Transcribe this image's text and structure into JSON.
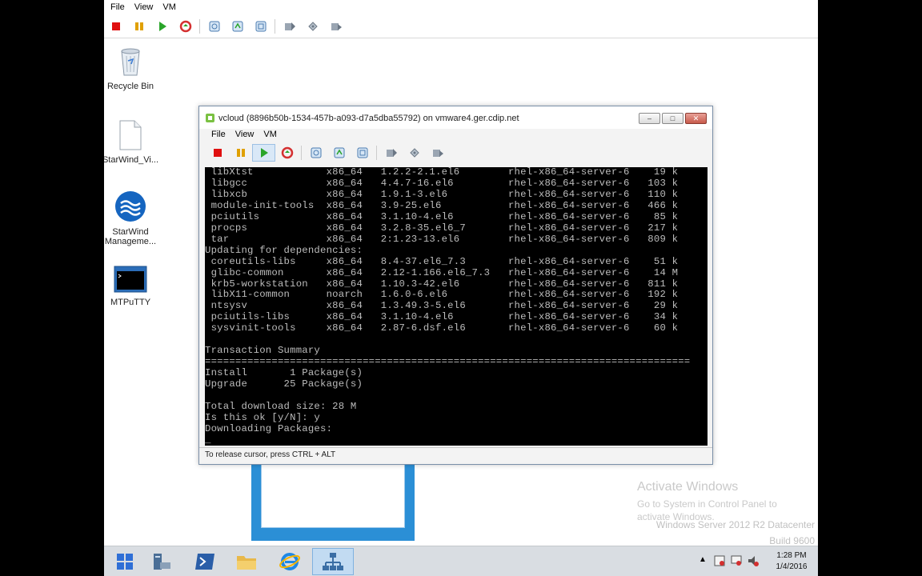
{
  "outer_vm": {
    "menu": [
      "File",
      "View",
      "VM"
    ],
    "toolbar_icons": [
      "stop-icon",
      "pause-icon",
      "play-icon",
      "reset-icon",
      "snapshot-icon",
      "revert-snapshot-icon",
      "manage-snapshots-icon",
      "send-keys-icon",
      "connect-cd-icon",
      "connect-floppy-icon"
    ]
  },
  "desktop": {
    "icons": [
      {
        "label": "Recycle Bin",
        "icon": "recycle-bin-icon"
      },
      {
        "label": "StarWind_Vi...",
        "icon": "document-icon"
      },
      {
        "label": "StarWind Manageme...",
        "icon": "starwind-icon"
      },
      {
        "label": "MTPuTTY",
        "icon": "putty-icon"
      }
    ]
  },
  "vcloud_window": {
    "title": "vcloud (8896b50b-1534-457b-a093-d7a5dba55792) on vmware4.ger.cdip.net",
    "menu": [
      "File",
      "View",
      "VM"
    ],
    "status": "To release cursor, press CTRL + ALT",
    "console_lines": [
      " libXtst            x86_64   1.2.2-2.1.el6        rhel-x86_64-server-6    19 k",
      " libgcc             x86_64   4.4.7-16.el6         rhel-x86_64-server-6   103 k",
      " libxcb             x86_64   1.9.1-3.el6          rhel-x86_64-server-6   110 k",
      " module-init-tools  x86_64   3.9-25.el6           rhel-x86_64-server-6   466 k",
      " pciutils           x86_64   3.1.10-4.el6         rhel-x86_64-server-6    85 k",
      " procps             x86_64   3.2.8-35.el6_7       rhel-x86_64-server-6   217 k",
      " tar                x86_64   2:1.23-13.el6        rhel-x86_64-server-6   809 k",
      "Updating for dependencies:",
      " coreutils-libs     x86_64   8.4-37.el6_7.3       rhel-x86_64-server-6    51 k",
      " glibc-common       x86_64   2.12-1.166.el6_7.3   rhel-x86_64-server-6    14 M",
      " krb5-workstation   x86_64   1.10.3-42.el6        rhel-x86_64-server-6   811 k",
      " libX11-common      noarch   1.6.0-6.el6          rhel-x86_64-server-6   192 k",
      " ntsysv             x86_64   1.3.49.3-5.el6       rhel-x86_64-server-6    29 k",
      " pciutils-libs      x86_64   3.1.10-4.el6         rhel-x86_64-server-6    34 k",
      " sysvinit-tools     x86_64   2.87-6.dsf.el6       rhel-x86_64-server-6    60 k",
      "",
      "Transaction Summary",
      "================================================================================",
      "Install       1 Package(s)",
      "Upgrade      25 Package(s)",
      "",
      "Total download size: 28 M",
      "Is this ok [y/N]: y",
      "Downloading Packages:",
      "_"
    ]
  },
  "watermark": {
    "title": "Activate Windows",
    "line1": "Go to System in Control Panel to",
    "line2": "activate Windows.",
    "edition": "Windows Server 2012 R2 Datacenter",
    "build": "Build 9600"
  },
  "taskbar": {
    "time": "1:28 PM",
    "date": "1/4/2016"
  }
}
